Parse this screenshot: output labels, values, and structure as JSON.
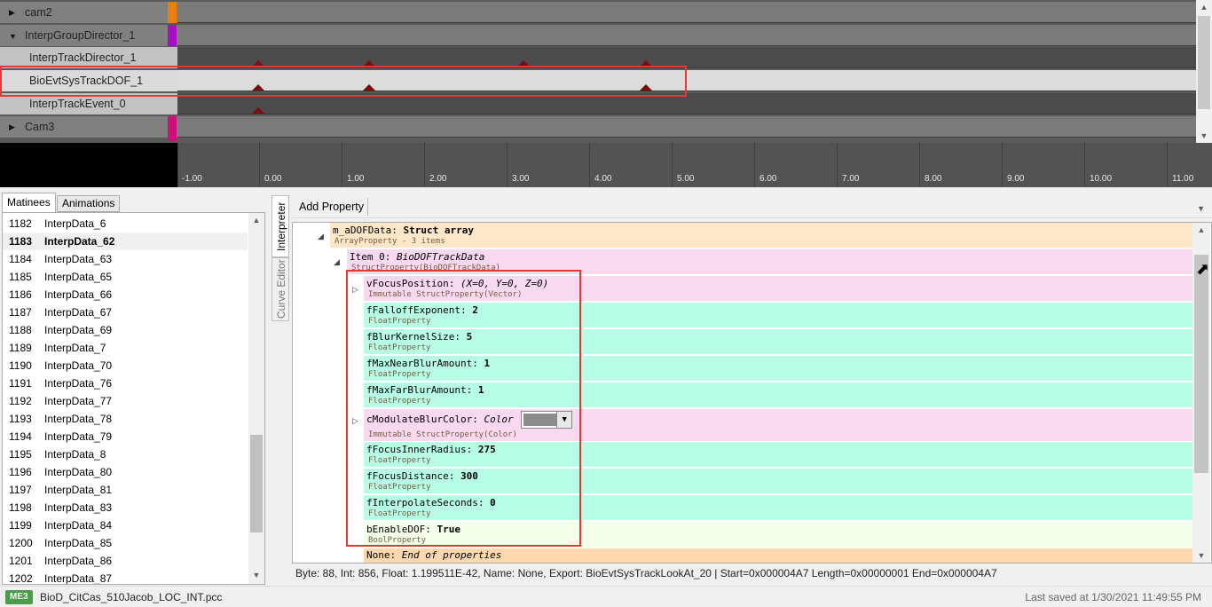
{
  "tracks": [
    {
      "label": "cam2",
      "kind": "group",
      "expanded": false,
      "color": "#e87f0a"
    },
    {
      "label": "InterpGroupDirector_1",
      "kind": "group",
      "expanded": true,
      "color": "#a40fc4"
    },
    {
      "label": "InterpTrackDirector_1",
      "kind": "track"
    },
    {
      "label": "BioEvtSysTrackDOF_1",
      "kind": "track",
      "selected": true
    },
    {
      "label": "InterpTrackEvent_0",
      "kind": "track"
    },
    {
      "label": "Cam3",
      "kind": "group",
      "expanded": false,
      "color": "#d0107a"
    }
  ],
  "ruler_ticks": [
    "-1.00",
    "0.00",
    "1.00",
    "2.00",
    "3.00",
    "4.00",
    "5.00",
    "6.00",
    "7.00",
    "8.00",
    "9.00",
    "10.00",
    "11.00"
  ],
  "left_tabs": {
    "matinees": "Matinees",
    "animations": "Animations"
  },
  "matinee_list": [
    {
      "num": "1182",
      "name": "InterpData_6"
    },
    {
      "num": "1183",
      "name": "InterpData_62",
      "selected": true
    },
    {
      "num": "1184",
      "name": "InterpData_63"
    },
    {
      "num": "1185",
      "name": "InterpData_65"
    },
    {
      "num": "1186",
      "name": "InterpData_66"
    },
    {
      "num": "1187",
      "name": "InterpData_67"
    },
    {
      "num": "1188",
      "name": "InterpData_69"
    },
    {
      "num": "1189",
      "name": "InterpData_7"
    },
    {
      "num": "1190",
      "name": "InterpData_70"
    },
    {
      "num": "1191",
      "name": "InterpData_76"
    },
    {
      "num": "1192",
      "name": "InterpData_77"
    },
    {
      "num": "1193",
      "name": "InterpData_78"
    },
    {
      "num": "1194",
      "name": "InterpData_79"
    },
    {
      "num": "1195",
      "name": "InterpData_8"
    },
    {
      "num": "1196",
      "name": "InterpData_80"
    },
    {
      "num": "1197",
      "name": "InterpData_81"
    },
    {
      "num": "1198",
      "name": "InterpData_83"
    },
    {
      "num": "1199",
      "name": "InterpData_84"
    },
    {
      "num": "1200",
      "name": "InterpData_85"
    },
    {
      "num": "1201",
      "name": "InterpData_86"
    },
    {
      "num": "1202",
      "name": "InterpData_87"
    }
  ],
  "vertical_tabs": {
    "interpreter": "Interpreter",
    "curve_editor": "Curve Editor"
  },
  "toolbar": {
    "add_property": "Add Property"
  },
  "properties": {
    "root": {
      "name": "m_aDOFData: ",
      "value": "Struct array",
      "type": "ArrayProperty - 3 items"
    },
    "item0": {
      "name": "Item 0: ",
      "value": "BioDOFTrackData",
      "type": "StructProperty(BioDOFTrackData)"
    },
    "vFocusPosition": {
      "name": "vFocusPosition: ",
      "value": "(X=0, Y=0, Z=0)",
      "type": "Immutable StructProperty(Vector)"
    },
    "fFalloffExponent": {
      "name": "fFalloffExponent: ",
      "value": "2",
      "type": "FloatProperty"
    },
    "fBlurKernelSize": {
      "name": "fBlurKernelSize: ",
      "value": "5",
      "type": "FloatProperty"
    },
    "fMaxNearBlurAmount": {
      "name": "fMaxNearBlurAmount: ",
      "value": "1",
      "type": "FloatProperty"
    },
    "fMaxFarBlurAmount": {
      "name": "fMaxFarBlurAmount: ",
      "value": "1",
      "type": "FloatProperty"
    },
    "cModulateBlurColor": {
      "name": "cModulateBlurColor: ",
      "value": "Color",
      "type": "Immutable StructProperty(Color)",
      "swatch": "#8c8c8c"
    },
    "fFocusInnerRadius": {
      "name": "fFocusInnerRadius: ",
      "value": "275",
      "type": "FloatProperty"
    },
    "fFocusDistance": {
      "name": "fFocusDistance: ",
      "value": "300",
      "type": "FloatProperty"
    },
    "fInterpolateSeconds": {
      "name": "fInterpolateSeconds: ",
      "value": "0",
      "type": "FloatProperty"
    },
    "bEnableDOF": {
      "name": "bEnableDOF: ",
      "value": "True",
      "type": "BoolProperty"
    },
    "none": {
      "name": "None: ",
      "value": "End of properties"
    }
  },
  "status_line": "Byte: 88, Int: 856, Float: 1.199511E-42, Name: None, Export: BioEvtSysTrackLookAt_20 | Start=0x000004A7 Length=0x00000001 End=0x000004A7",
  "statusbar": {
    "game_badge": "ME3",
    "file_name": "BioD_CitCas_510Jacob_LOC_INT.pcc",
    "last_saved": "Last saved at 1/30/2021 11:49:55 PM"
  },
  "colors": {
    "selection_outline": "#e53935",
    "keyframe": "#7a0d0d"
  }
}
